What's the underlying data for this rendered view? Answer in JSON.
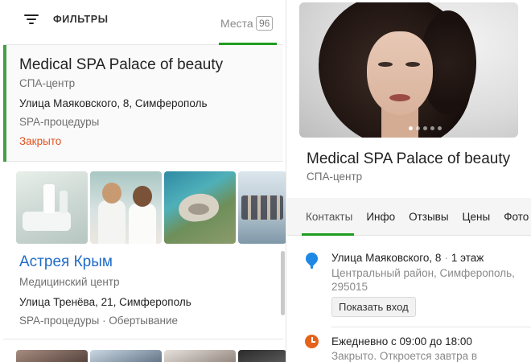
{
  "list_header": {
    "filter_label": "ФИЛЬТРЫ",
    "places_label": "Места",
    "places_count": "96"
  },
  "results": [
    {
      "title": "Medical SPA Palace of beauty",
      "category": "СПА-центр",
      "address": "Улица Маяковского, 8, Симферополь",
      "tags": "SPA-процедуры",
      "status": "Закрыто",
      "selected": true
    },
    {
      "title": "Астрея Крым",
      "category": "Медицинский центр",
      "address": "Улица Тренёва, 21, Симферополь",
      "tags": "SPA-процедуры · Обертывание"
    }
  ],
  "details": {
    "title": "Medical SPA Palace of beauty",
    "category": "СПА-центр",
    "tabs": [
      "Контакты",
      "Инфо",
      "Отзывы",
      "Цены",
      "Фото"
    ],
    "active_tab": "Контакты",
    "photo_count": 5,
    "photo_active_index": 0,
    "address_street": "Улица Маяковского, 8",
    "address_floor": "1 этаж",
    "address_area": "Центральный район, Симферополь, 295015",
    "show_entrance_button": "Показать вход",
    "hours": "Ежедневно с 09:00 до 18:00",
    "hours_status": "Закрыто. Откроется завтра в"
  },
  "colors": {
    "accent_green": "#1e9d1e",
    "closed_orange": "#e0531f",
    "link_blue": "#1f6cc7",
    "pin_blue": "#1e88e5",
    "clock_orange": "#e6621b"
  },
  "icons": {
    "filter": "filter-lines-icon",
    "address": "map-pin-icon",
    "hours": "clock-icon"
  }
}
